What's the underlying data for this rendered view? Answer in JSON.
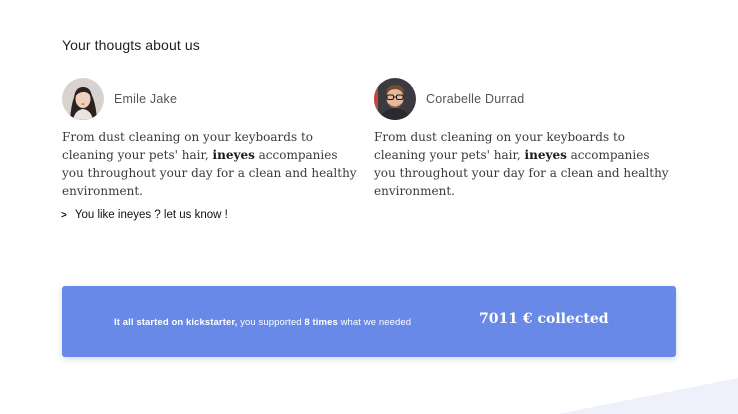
{
  "section": {
    "title": "Your thougts about us"
  },
  "testimonials": [
    {
      "name": "Emile Jake",
      "avatar_icon": "woman-portrait",
      "quote_before": "From dust cleaning on your keyboards to cleaning your pets' hair, ",
      "quote_brand": "ineyes",
      "quote_after": " accompanies you throughout your day for a clean and healthy environment."
    },
    {
      "name": "Corabelle Durrad",
      "avatar_icon": "man-with-glasses-portrait",
      "quote_before": "From dust cleaning on your keyboards to cleaning your pets' hair, ",
      "quote_brand": "ineyes",
      "quote_after": " accompanies you throughout your day for a clean and healthy environment."
    }
  ],
  "cta": {
    "chevron": ">",
    "label": "You like ineyes ? let us know !"
  },
  "banner": {
    "bold_start": "It all started on kickstarter,",
    "middle": " you supported ",
    "bold_times": "8 times",
    "end": " what we needed",
    "amount": "7011 € collected",
    "color": "#6889e8"
  }
}
